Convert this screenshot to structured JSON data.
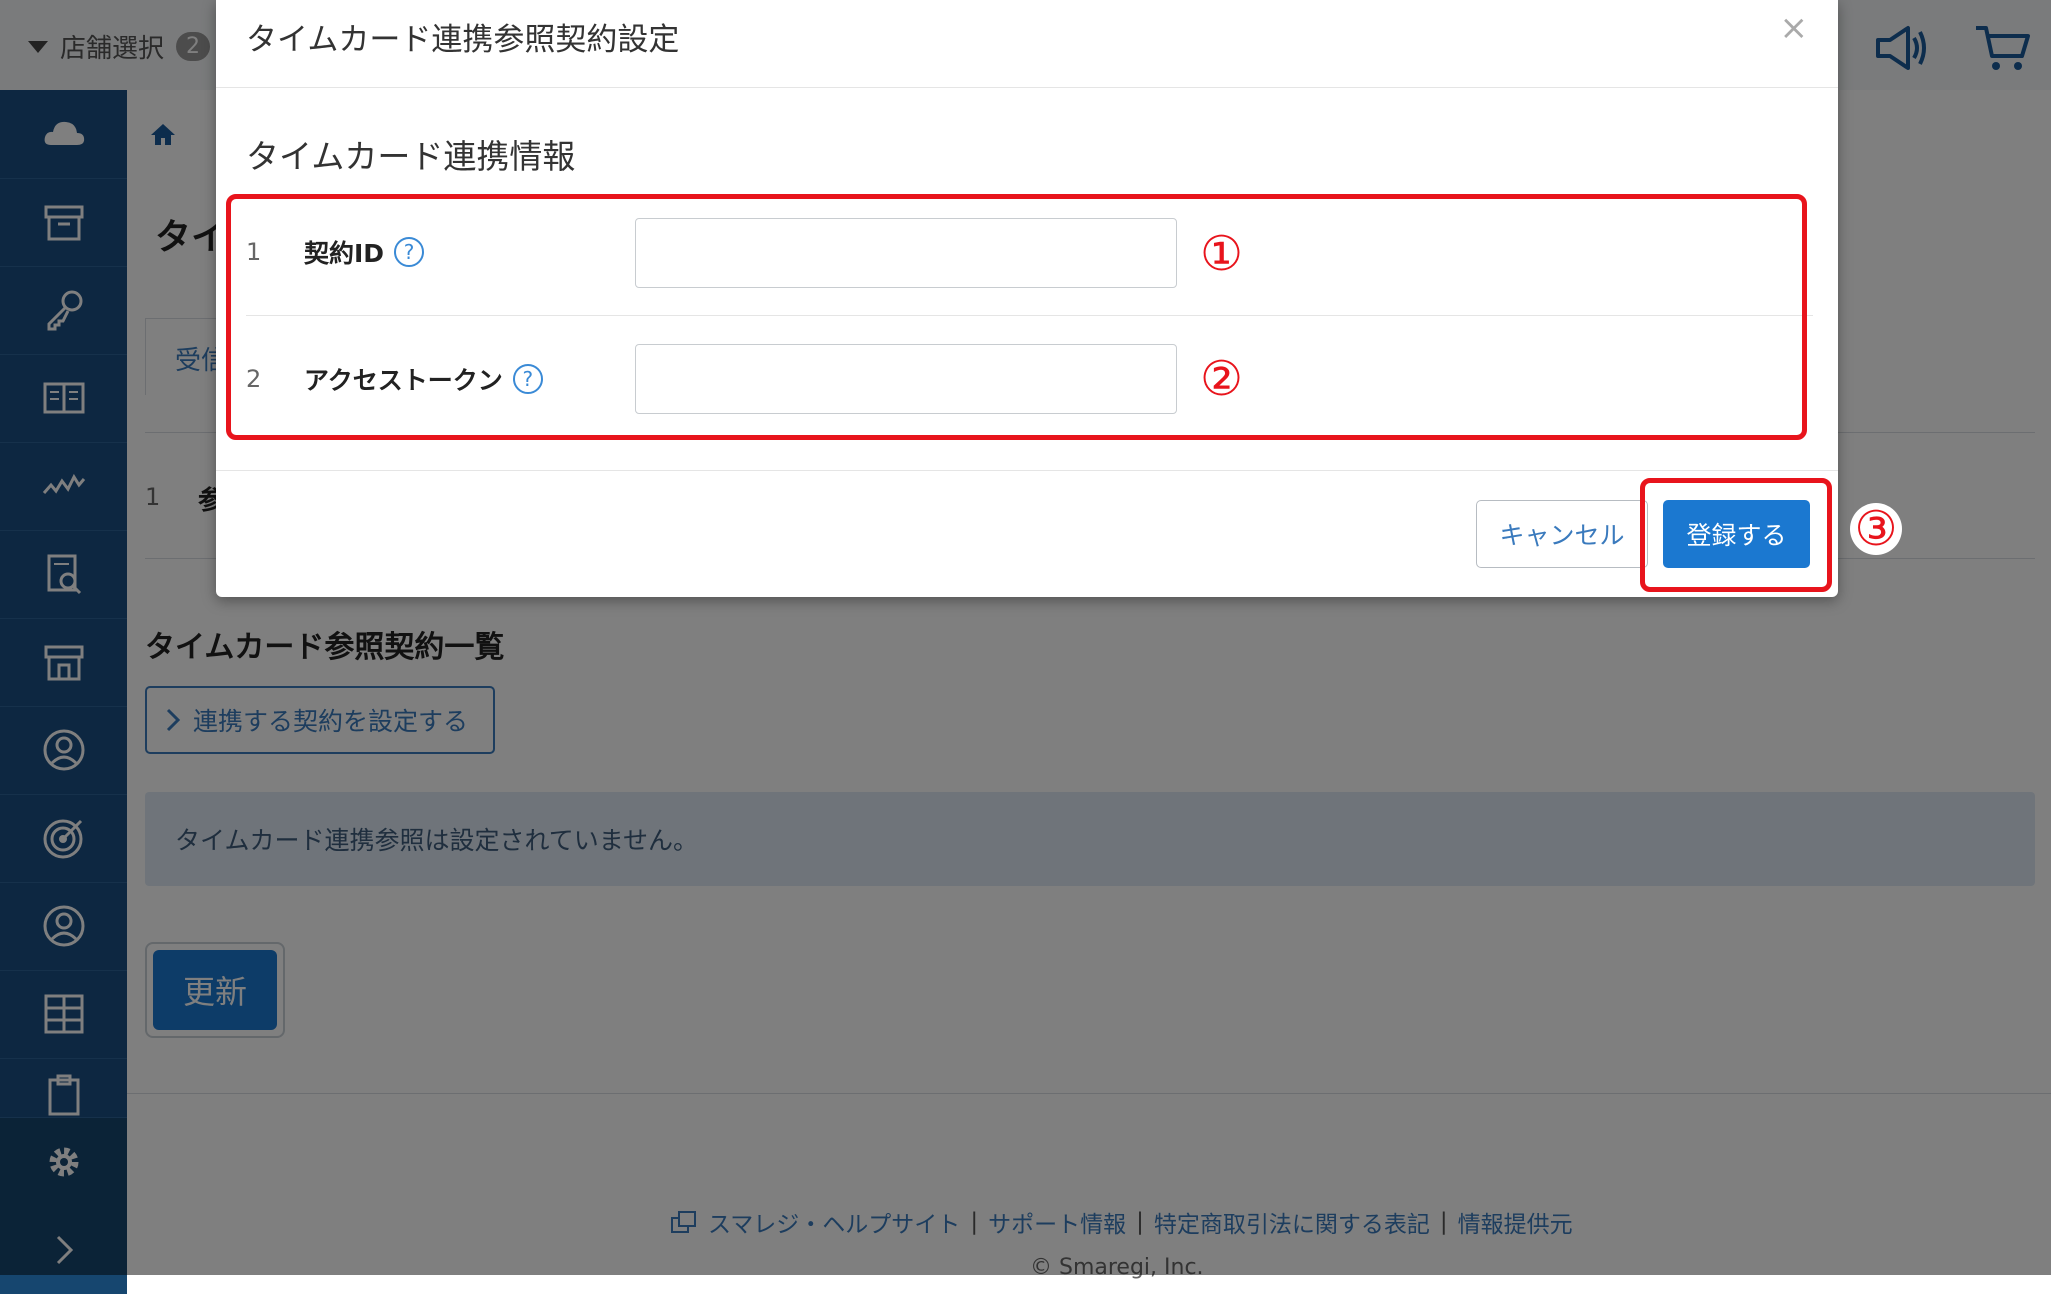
{
  "header": {
    "store_select_label": "店舗選択",
    "store_count": "2"
  },
  "page": {
    "title_partial": "タイ",
    "tab_partial": "受信",
    "row_number": "1",
    "row_partial": "参",
    "list_title": "タイムカード参照契約一覧",
    "set_contract_button": "連携する契約を設定する",
    "empty_message": "タイムカード連携参照は設定されていません。",
    "update_button": "更新"
  },
  "footer": {
    "links": [
      "スマレジ・ヘルプサイト",
      "サポート情報",
      "特定商取引法に関する表記",
      "情報提供元"
    ],
    "separator": "|",
    "copyright": "© Smaregi, Inc."
  },
  "modal": {
    "title": "タイムカード連携参照契約設定",
    "close": "×",
    "section_title": "タイムカード連携情報",
    "fields": [
      {
        "number": "1",
        "label": "契約ID",
        "help": "?",
        "value": ""
      },
      {
        "number": "2",
        "label": "アクセストークン",
        "help": "?",
        "value": ""
      }
    ],
    "cancel_button": "キャンセル",
    "register_button": "登録する"
  },
  "annotations": {
    "mark1": "①",
    "mark2": "②",
    "mark3": "③",
    "color": "#e8141c"
  },
  "colors": {
    "sidebar": "#1a4f82",
    "primary": "#1b78d0",
    "link": "#3a7abd"
  }
}
